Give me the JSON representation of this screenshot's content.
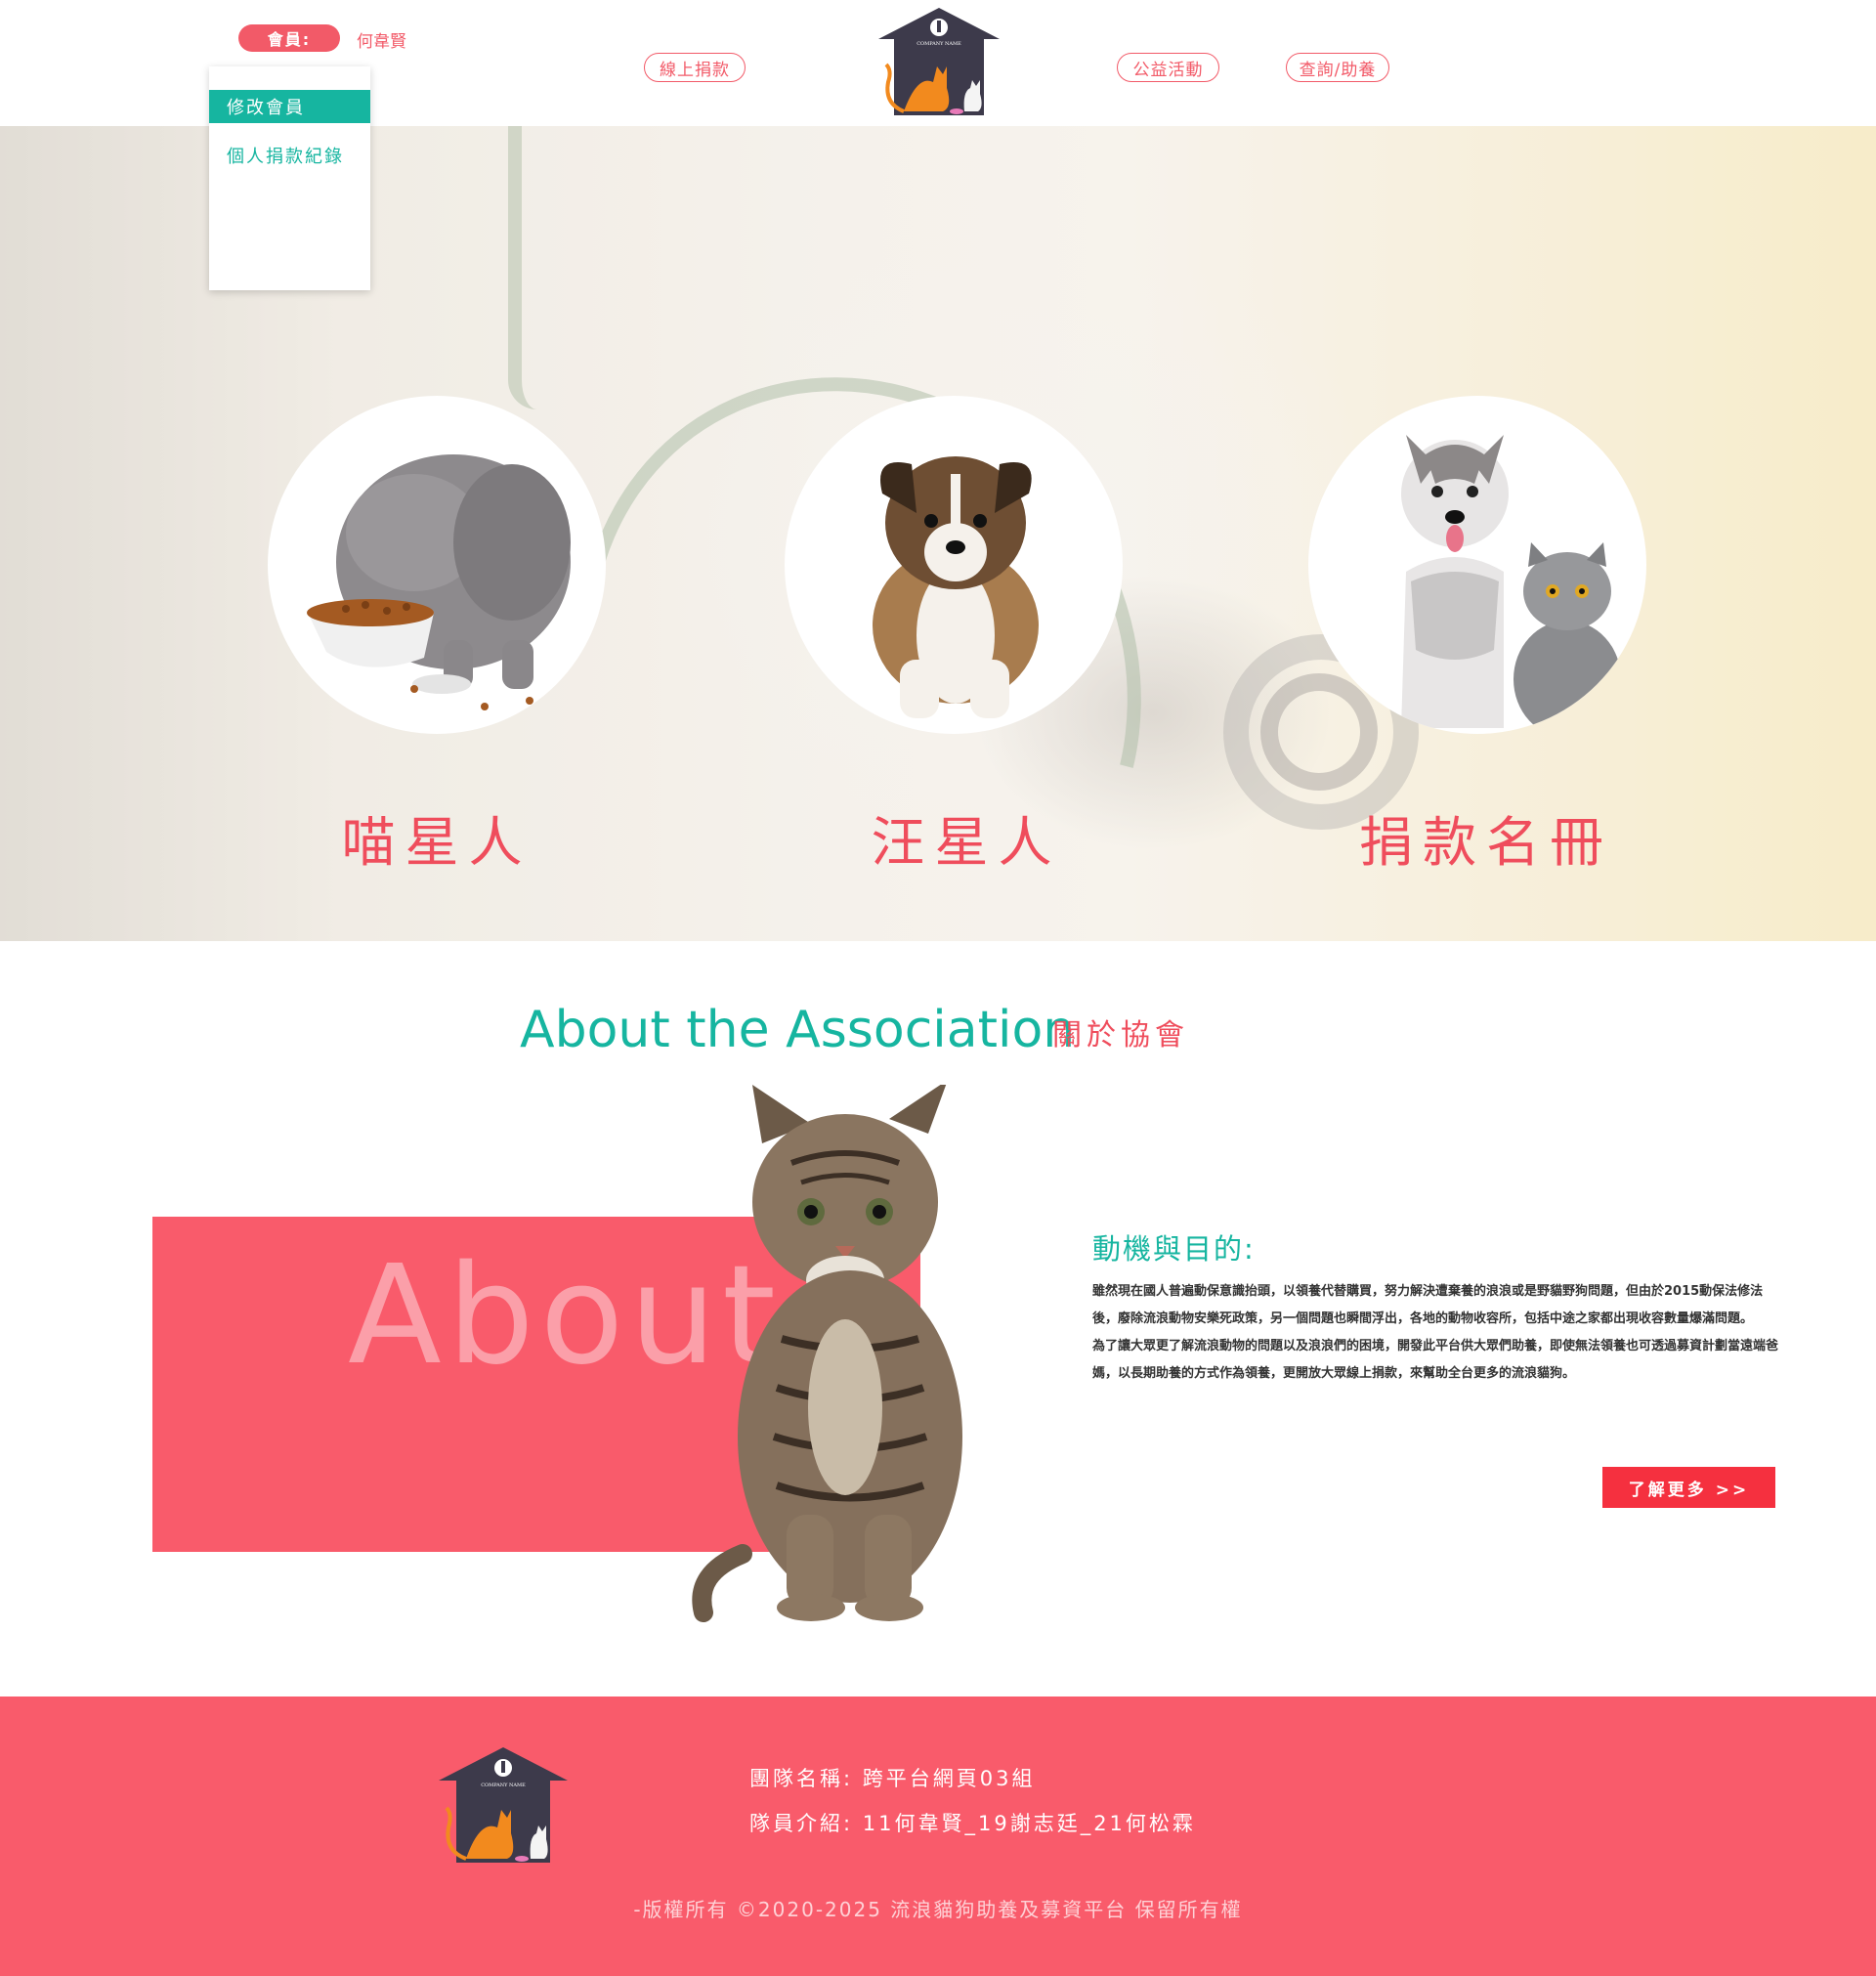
{
  "header": {
    "member_label": "會員:",
    "member_name": "何韋賢",
    "nav": [
      "線上捐款",
      "公益活動",
      "查詢/助養"
    ],
    "logo_text": "COMPANY NAME"
  },
  "dropdown": {
    "items": [
      "修改會員",
      "個人捐款紀錄"
    ]
  },
  "hero": {
    "cards": [
      {
        "label": "喵星人",
        "icon": "kitten-eating-icon"
      },
      {
        "label": "汪星人",
        "icon": "puppy-icon"
      },
      {
        "label": "捐款名冊",
        "icon": "husky-and-cat-icon"
      }
    ]
  },
  "about": {
    "title": "About the Association",
    "subtitle": "關於協會",
    "block_word": "About",
    "motive_title": "動機與目的:",
    "paragraph1": "雖然現在國人普遍動保意識抬頭，以領養代替購買，努力解決遭棄養的浪浪或是野貓野狗問題，但由於2015動保法修法後，廢除流浪動物安樂死政策，另一個問題也瞬間浮出，各地的動物收容所，包括中途之家都出現收容數量爆滿問題。",
    "paragraph2": "為了讓大眾更了解流浪動物的問題以及浪浪們的困境，開發此平台供大眾們助養，即使無法領養也可透過募資計劃當遠端爸媽，以長期助養的方式作為領養，更開放大眾線上捐款，來幫助全台更多的流浪貓狗。",
    "more_button": "了解更多 >>"
  },
  "footer": {
    "team_name": "團隊名稱:  跨平台網頁03組",
    "team_members": "隊員介紹:  11何韋賢_19謝志廷_21何松霖",
    "copyright": "-版權所有 ©2020-2025 流浪貓狗助養及募資平台 保留所有權",
    "logo_text": "COMPANY NAME"
  },
  "colors": {
    "accent_red": "#f95b6b",
    "accent_teal": "#16b5a0",
    "button_red": "#f5303f"
  }
}
